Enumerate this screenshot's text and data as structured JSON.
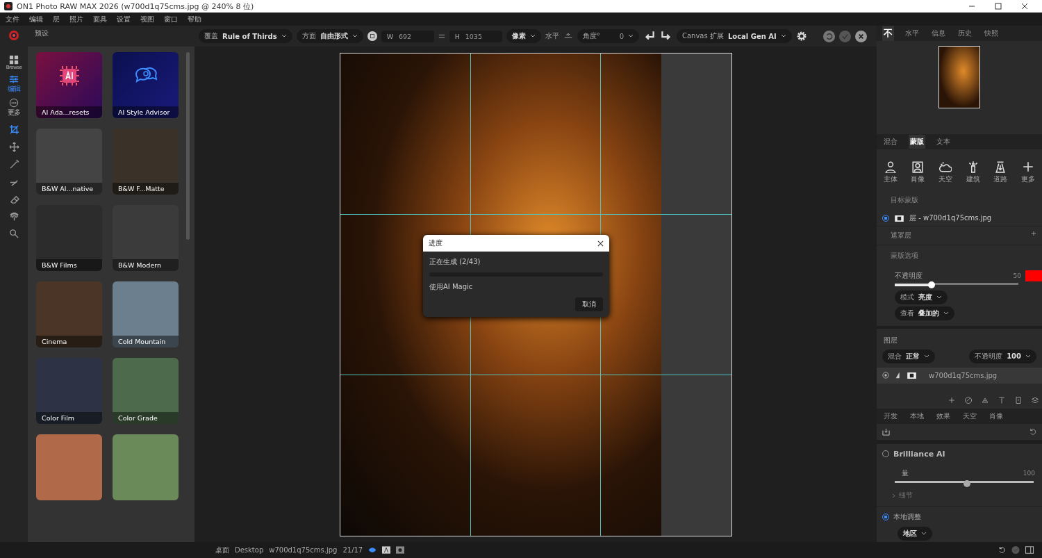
{
  "window": {
    "title": "ON1 Photo RAW MAX 2026 (w700d1q75cms.jpg @ 240% 8 位)"
  },
  "menu": [
    "文件",
    "编辑",
    "层",
    "照片",
    "面具",
    "设置",
    "视图",
    "窗口",
    "帮助"
  ],
  "rail": {
    "modules": [
      {
        "label": "Browse",
        "selected": false
      },
      {
        "label": "编辑",
        "selected": true
      },
      {
        "label": "更多",
        "selected": false
      }
    ],
    "tools": [
      {
        "selected": true
      },
      {
        "selected": false
      },
      {
        "selected": false
      },
      {
        "selected": false
      },
      {
        "selected": false
      },
      {
        "selected": false
      },
      {
        "selected": false
      }
    ]
  },
  "presets": {
    "title": "预设",
    "items": [
      {
        "label": "AI Ada...resets",
        "kind": "ai-chip"
      },
      {
        "label": "AI Style Advisor",
        "kind": "ai-chat"
      },
      {
        "label": "B&W Al...native",
        "kind": "photo"
      },
      {
        "label": "B&W F...Matte",
        "kind": "photo"
      },
      {
        "label": "B&W Films",
        "kind": "photo"
      },
      {
        "label": "B&W Modern",
        "kind": "photo"
      },
      {
        "label": "Cinema",
        "kind": "photo"
      },
      {
        "label": "Cold Mountain",
        "kind": "photo"
      },
      {
        "label": "Color Film",
        "kind": "photo"
      },
      {
        "label": "Color Grade",
        "kind": "photo"
      },
      {
        "kind": "photo"
      },
      {
        "kind": "photo"
      }
    ]
  },
  "crop_bar": {
    "overlay": {
      "label": "覆盖",
      "value": "Rule of Thirds"
    },
    "aspect": {
      "label": "方面",
      "value": "自由形式"
    },
    "width": {
      "label": "W",
      "value": "692"
    },
    "height": {
      "label": "H",
      "value": "1035"
    },
    "unit": "像素",
    "level": "水平",
    "angle": {
      "label": "角度°",
      "value": "0"
    },
    "canvas": {
      "label": "Canvas 扩展",
      "value": "Local Gen AI"
    }
  },
  "dialog": {
    "title": "进度",
    "status": "正在生成 (2/43)",
    "level": 0,
    "message": "使用AI Magic",
    "cancel": "取消"
  },
  "right_tabs": [
    {
      "label": "不",
      "selected": true
    },
    {
      "label": "水平",
      "selected": false
    },
    {
      "label": "信息",
      "selected": false
    },
    {
      "label": "历史",
      "selected": false
    },
    {
      "label": "快照",
      "selected": false
    }
  ],
  "mask_panel": {
    "tabs": [
      {
        "label": "混合",
        "selected": false
      },
      {
        "label": "蒙版",
        "selected": true
      },
      {
        "label": "文本",
        "selected": false
      }
    ],
    "tools": [
      "主体",
      "肖像",
      "天空",
      "建筑",
      "道路",
      "更多"
    ],
    "target_header": "目标蒙版",
    "target_item": {
      "label": "层 - w700d1q75cms.jpg",
      "selected": true
    },
    "mask_layers": "遮罩层",
    "options": "蒙版选项",
    "opacity": {
      "label": "不透明度",
      "reading": "50",
      "level": 0.3,
      "color": "#ff0000"
    },
    "mode": {
      "label": "模式",
      "value": "亮度"
    },
    "view": {
      "label": "查看",
      "value": "叠加的"
    }
  },
  "layers": {
    "title": "图层",
    "blend": {
      "label": "混合",
      "value": "正常"
    },
    "opacity": {
      "label": "不透明度",
      "value": "100"
    },
    "items": [
      {
        "name": "w700d1q75cms.jpg",
        "selected": true
      }
    ]
  },
  "develop": {
    "tabs": [
      {
        "label": "开发",
        "selected": false
      },
      {
        "label": "本地",
        "selected": false
      },
      {
        "label": "效果",
        "selected": false
      },
      {
        "label": "天空",
        "selected": false
      },
      {
        "label": "肖像",
        "selected": false
      }
    ],
    "brilliance": {
      "title": "Brilliance AI",
      "on": false,
      "amount": {
        "label": "量",
        "reading": "100",
        "level": 0.52
      },
      "details": "细节"
    },
    "local": {
      "title": "本地调整",
      "on": true,
      "region": "地区"
    }
  },
  "status_bar": {
    "location": "桌面",
    "folder": "Desktop",
    "file": "w700d1q75cms.jpg",
    "info": "21/17"
  }
}
